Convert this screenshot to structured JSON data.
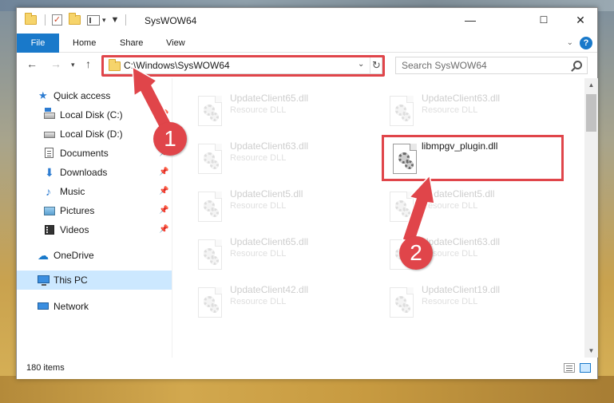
{
  "window": {
    "title": "SysWOW64",
    "controls": {
      "minimize": "—",
      "maximize": "☐",
      "close": "✕"
    }
  },
  "ribbon": {
    "tabs": [
      "File",
      "Home",
      "Share",
      "View"
    ],
    "help": "?"
  },
  "address_bar": {
    "path": "C:\\Windows\\SysWOW64",
    "search_placeholder": "Search SysWOW64"
  },
  "nav_pane": {
    "quick_access": "Quick access",
    "items": [
      {
        "label": "Local Disk (C:)",
        "icon": "local-disk-icon",
        "pinned": true
      },
      {
        "label": "Local Disk (D:)",
        "icon": "local-disk-icon",
        "pinned": false
      },
      {
        "label": "Documents",
        "icon": "documents-icon",
        "pinned": true
      },
      {
        "label": "Downloads",
        "icon": "downloads-icon",
        "pinned": true
      },
      {
        "label": "Music",
        "icon": "music-icon",
        "pinned": true
      },
      {
        "label": "Pictures",
        "icon": "pictures-icon",
        "pinned": true
      },
      {
        "label": "Videos",
        "icon": "videos-icon",
        "pinned": true
      }
    ],
    "onedrive": "OneDrive",
    "this_pc": "This PC",
    "network": "Network"
  },
  "files": [
    {
      "name": "UpdateClient65.dll",
      "type": "Resource DLL",
      "faded": true
    },
    {
      "name": "UpdateClient63.dll",
      "type": "Resource DLL",
      "faded": true
    },
    {
      "name": "UpdateClient63.dll",
      "type": "Resource DLL",
      "faded": true
    },
    {
      "name": "libmpgv_plugin.dll",
      "type": "",
      "faded": false
    },
    {
      "name": "UpdateClient5.dll",
      "type": "Resource DLL",
      "faded": true
    },
    {
      "name": "UpdateClient5.dll",
      "type": "Resource DLL",
      "faded": true
    },
    {
      "name": "UpdateClient65.dll",
      "type": "Resource DLL",
      "faded": true
    },
    {
      "name": "UpdateClient63.dll",
      "type": "Resource DLL",
      "faded": true
    },
    {
      "name": "UpdateClient42.dll",
      "type": "Resource DLL",
      "faded": true
    },
    {
      "name": "UpdateClient19.dll",
      "type": "Resource DLL",
      "faded": true
    }
  ],
  "status": {
    "item_count": "180 items"
  },
  "annotations": {
    "step1": "1",
    "step2": "2",
    "color": "#e0454a"
  },
  "colors": {
    "accent": "#1979ca",
    "selection": "#cce8ff",
    "highlight": "#e0454a"
  }
}
